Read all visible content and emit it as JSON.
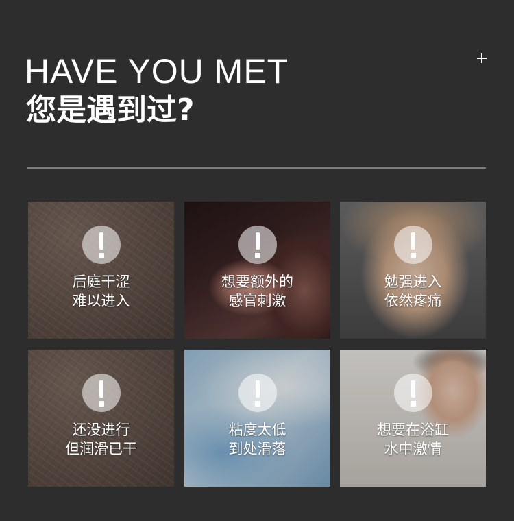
{
  "header": {
    "title_en": "HAVE YOU MET",
    "title_zh": "您是遇到过?",
    "plus_icon": "plus-icon"
  },
  "cards": [
    {
      "line1": "后庭干涩",
      "line2": "难以进入",
      "icon": "exclamation-icon"
    },
    {
      "line1": "想要额外的",
      "line2": "感官刺激",
      "icon": "exclamation-icon"
    },
    {
      "line1": "勉强进入",
      "line2": "依然疼痛",
      "icon": "exclamation-icon"
    },
    {
      "line1": "还没进行",
      "line2": "但润滑已干",
      "icon": "exclamation-icon"
    },
    {
      "line1": "粘度太低",
      "line2": "到处滑落",
      "icon": "exclamation-icon"
    },
    {
      "line1": "想要在浴缸",
      "line2": "水中激情",
      "icon": "exclamation-icon"
    }
  ],
  "colors": {
    "background": "#2d2d2d",
    "divider": "#7e7e7e",
    "icon_circle": "rgba(255,255,255,0.55)",
    "text": "#ffffff"
  }
}
